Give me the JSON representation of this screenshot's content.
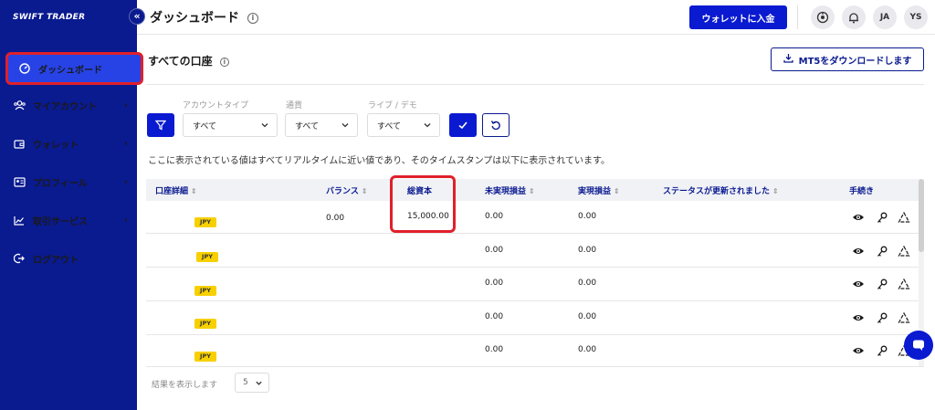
{
  "brand": {
    "logo": "SWIFT TRADER",
    "collapse_icon": "«"
  },
  "sidebar": {
    "items": [
      {
        "label": "ダッシュボード",
        "icon": "dashboard-icon"
      },
      {
        "label": "マイアカウント",
        "icon": "accounts-icon",
        "chevron": "›"
      },
      {
        "label": "ウォレット",
        "icon": "wallet-icon",
        "chevron": "›"
      },
      {
        "label": "プロフィール",
        "icon": "profile-icon",
        "chevron": "›"
      },
      {
        "label": "取引サービス",
        "icon": "chart-icon",
        "chevron": "›"
      },
      {
        "label": "ログアウト",
        "icon": "logout-icon"
      }
    ]
  },
  "header": {
    "title": "ダッシュボード",
    "info": "i",
    "deposit_label": "ウォレットに入金",
    "lang": "JA",
    "user": "YS"
  },
  "section": {
    "title": "すべての口座",
    "info": "i",
    "mt5_label": "MT5をダウンロードします"
  },
  "filters": {
    "account_type": {
      "label": "アカウントタイプ",
      "value": "すべて"
    },
    "currency": {
      "label": "通貨",
      "value": "すべて"
    },
    "live_demo": {
      "label": "ライブ / デモ",
      "value": "すべて"
    }
  },
  "notice": "ここに表示されている値はすべてリアルタイムに近い値であり、そのタイムスタンプは以下に表示されています。",
  "table": {
    "headers": [
      "口座詳細",
      "バランス",
      "総資本",
      "未実現損益",
      "実現損益",
      "ステータスが更新されました",
      "手続き"
    ],
    "sort_glyph": "⇕",
    "rows": [
      {
        "badge": "JPY",
        "balance": "0.00",
        "equity": "15,000.00",
        "unrealized": "0.00",
        "realized": "0.00"
      },
      {
        "badge": "JPY",
        "balance": "",
        "equity": "",
        "unrealized": "0.00",
        "realized": "0.00"
      },
      {
        "badge": "JPY",
        "balance": "",
        "equity": "",
        "unrealized": "0.00",
        "realized": "0.00"
      },
      {
        "badge": "JPY",
        "balance": "",
        "equity": "",
        "unrealized": "0.00",
        "realized": "0.00"
      },
      {
        "badge": "JPY",
        "balance": "",
        "equity": "",
        "unrealized": "0.00",
        "realized": "0.00"
      }
    ]
  },
  "pagination": {
    "label": "結果を表示します",
    "rows_value": "5"
  },
  "colors": {
    "sidebar": "#0a1a8f",
    "primary": "#0a1ad0",
    "highlight": "#e0202a",
    "badge": "#f7d000"
  }
}
